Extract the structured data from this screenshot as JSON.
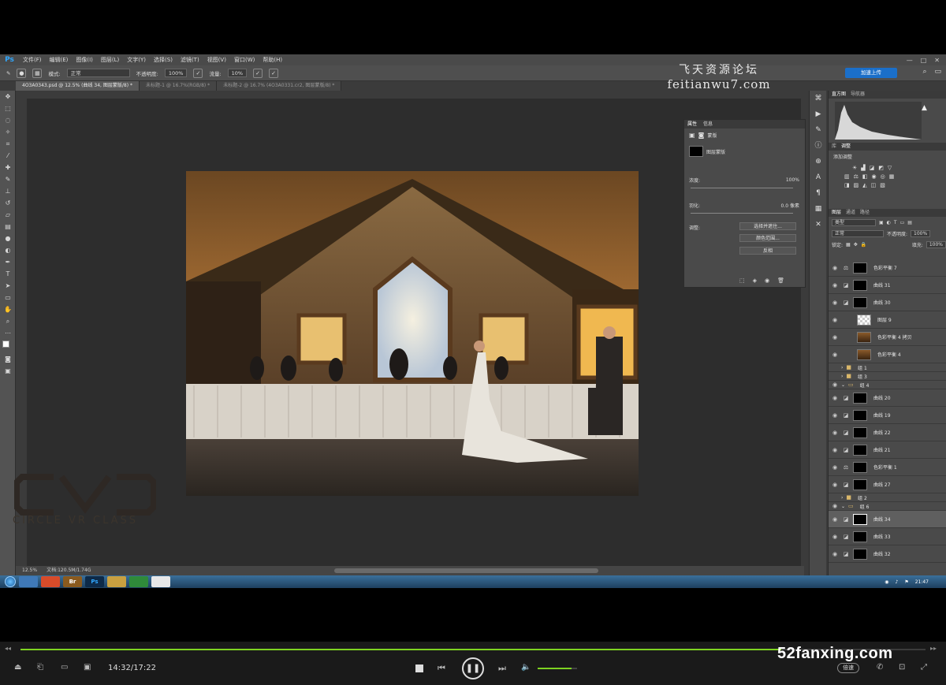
{
  "menubar": {
    "logo": "Ps",
    "items": [
      "文件(F)",
      "编辑(E)",
      "图像(I)",
      "图层(L)",
      "文字(Y)",
      "选择(S)",
      "滤镜(T)",
      "视图(V)",
      "窗口(W)",
      "帮助(H)"
    ],
    "window_controls": [
      "—",
      "□",
      "✕"
    ]
  },
  "options": {
    "mode_label": "模式:",
    "mode_value": "正常",
    "opacity_label": "不透明度:",
    "opacity_value": "100%",
    "flow_label": "流量:",
    "flow_value": "10%",
    "cloud_button": "加速上传"
  },
  "doc_tabs": [
    "4O3A0343.psd @ 12.5% (曲线 34, 图层蒙版/8) *",
    "未标题-1 @ 16.7%(RGB/8) *",
    "未标题-2 @ 16.7% (4O3A0331.cr2, 图层蒙版/8) *"
  ],
  "watermark": {
    "line1": "飞天资源论坛",
    "line2": "feitianwu7.com"
  },
  "logo_overlay": {
    "subtitle": "CIRCLE VR CLASS"
  },
  "status": {
    "zoom": "12.5%",
    "doc": "文档:120.5M/1.74G"
  },
  "properties": {
    "tabs": [
      "属性",
      "信息"
    ],
    "header": "蒙版",
    "mask_label": "图层蒙版",
    "density_label": "浓度:",
    "density_value": "100%",
    "feather_label": "羽化:",
    "feather_value": "0.0 像素",
    "adjust_label": "调整:",
    "buttons": [
      "选择并遮住...",
      "颜色范围...",
      "反相"
    ]
  },
  "histogram": {
    "tabs": [
      "直方图",
      "导航器"
    ]
  },
  "adjustments": {
    "tabs": [
      "库",
      "调整"
    ],
    "title": "添加调整"
  },
  "layers": {
    "tabs": [
      "图层",
      "通道",
      "路径"
    ],
    "kind": "类型",
    "blend": "正常",
    "opacity_label": "不透明度:",
    "opacity_value": "100%",
    "lock_label": "锁定:",
    "fill_label": "填充:",
    "fill_value": "100%",
    "items": [
      {
        "name": "色彩平衡 7",
        "kind": "adj"
      },
      {
        "name": "曲线 31",
        "kind": "adj"
      },
      {
        "name": "曲线 30",
        "kind": "adj"
      },
      {
        "name": "图层 9",
        "kind": "checker"
      },
      {
        "name": "色彩平衡 4 拷贝",
        "kind": "img"
      },
      {
        "name": "色彩平衡 4",
        "kind": "img"
      },
      {
        "name": "组 1",
        "kind": "group"
      },
      {
        "name": "组 3",
        "kind": "group"
      },
      {
        "name": "组 4",
        "kind": "group"
      },
      {
        "name": "曲线 20",
        "kind": "adj"
      },
      {
        "name": "曲线 19",
        "kind": "adj"
      },
      {
        "name": "曲线 22",
        "kind": "adj"
      },
      {
        "name": "曲线 21",
        "kind": "adj"
      },
      {
        "name": "色彩平衡 1",
        "kind": "adj"
      },
      {
        "name": "曲线 27",
        "kind": "adj"
      },
      {
        "name": "组 2",
        "kind": "group"
      },
      {
        "name": "组 6",
        "kind": "group"
      },
      {
        "name": "曲线 34",
        "kind": "adj",
        "selected": true
      },
      {
        "name": "曲线 33",
        "kind": "adj"
      },
      {
        "name": "曲线 32",
        "kind": "adj"
      }
    ]
  },
  "taskbar": {
    "apps": [
      "",
      "",
      "Br",
      "Ps",
      "",
      "",
      ""
    ],
    "time": "21:47"
  },
  "player": {
    "progress": 0.8402,
    "time": "14:32/17:22",
    "speed": "倍速",
    "brand": "52fanxing.com",
    "volume": 0.85
  }
}
